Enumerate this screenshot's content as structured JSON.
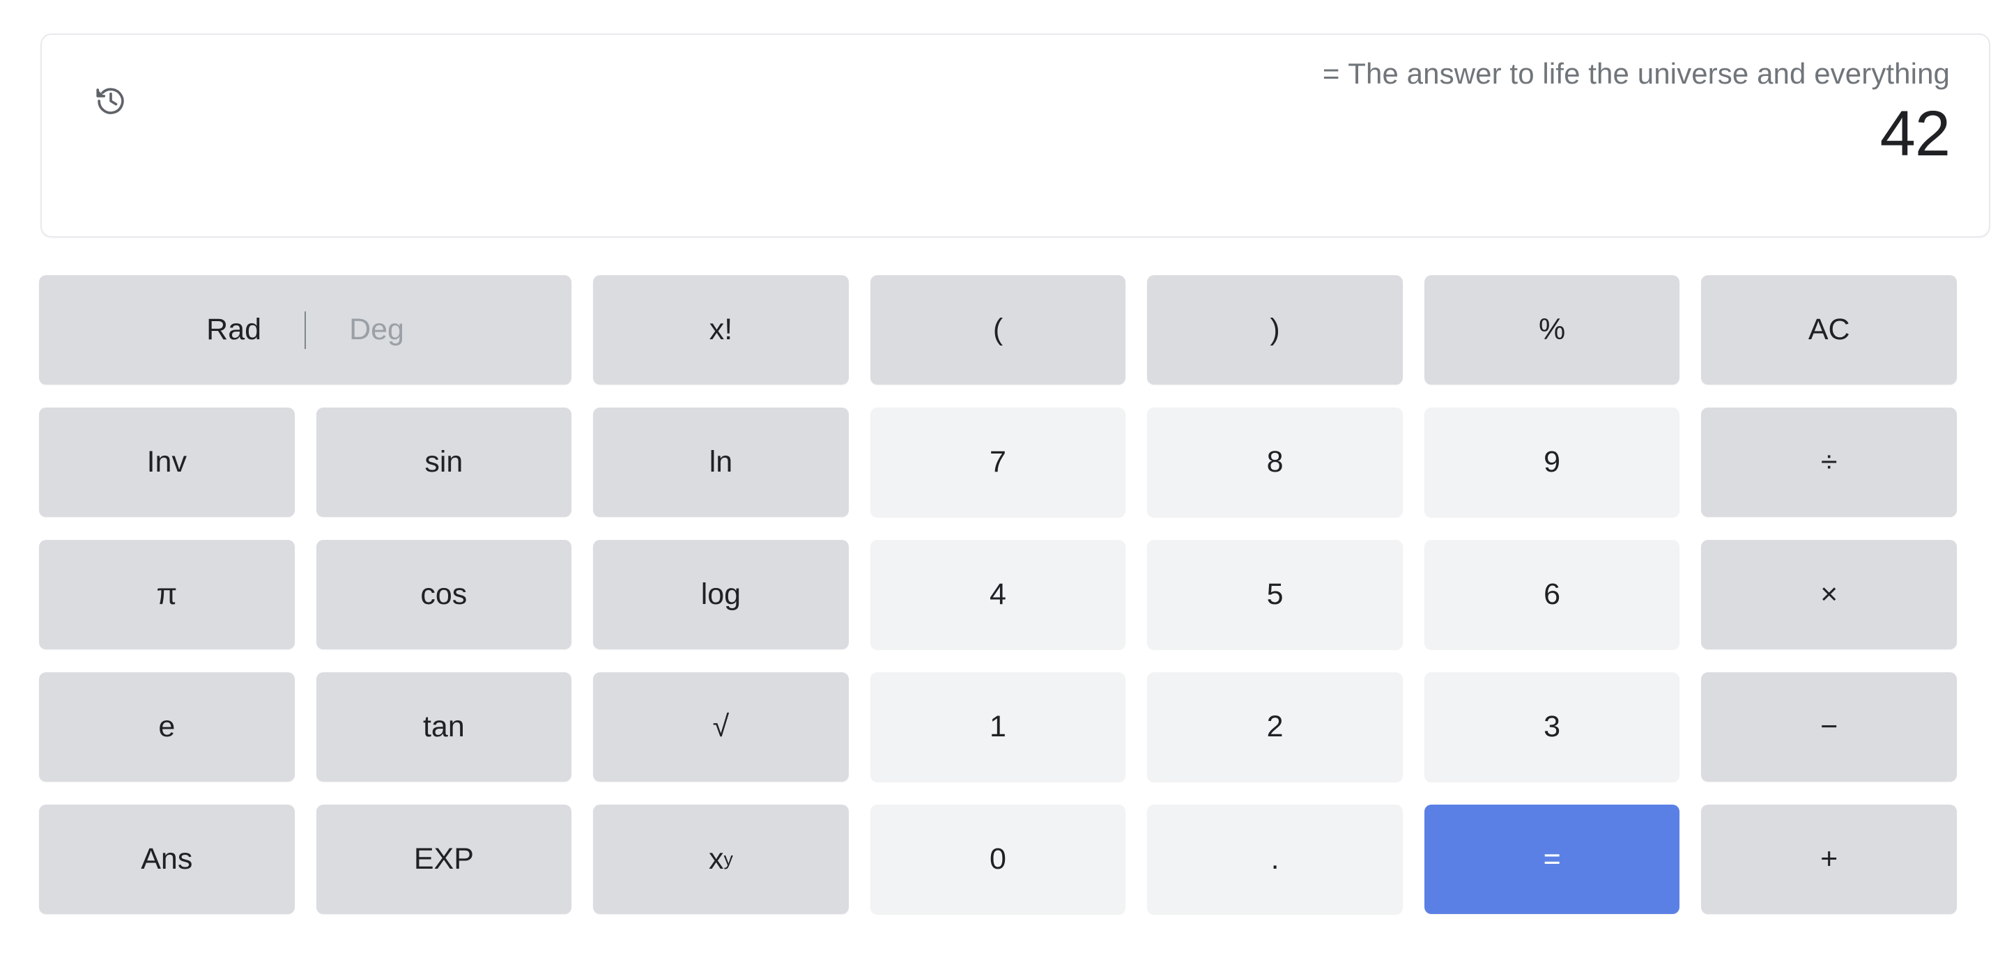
{
  "display": {
    "history_icon": "history-icon",
    "expression": "The answer to life the universe and everything =",
    "result": "42"
  },
  "angle_toggle": {
    "rad_label": "Rad",
    "deg_label": "Deg",
    "selected": "Rad"
  },
  "colors": {
    "function_key": "#dadce0",
    "number_key": "#f1f3f4",
    "equals_key": "#5b80e5",
    "text": "#202124",
    "muted_text": "#70757a",
    "inactive_text": "#9aa0a6"
  },
  "keys": {
    "factorial": "x!",
    "paren_open": "(",
    "paren_close": ")",
    "percent": "%",
    "all_clear": "AC",
    "inverse": "Inv",
    "sin": "sin",
    "ln": "ln",
    "seven": "7",
    "eight": "8",
    "nine": "9",
    "divide": "÷",
    "pi": "π",
    "cos": "cos",
    "log": "log",
    "four": "4",
    "five": "5",
    "six": "6",
    "multiply": "×",
    "euler": "e",
    "tan": "tan",
    "sqrt": "√",
    "one": "1",
    "two": "2",
    "three": "3",
    "minus": "−",
    "answer": "Ans",
    "exponent": "EXP",
    "power_base": "x",
    "power_sup": "y",
    "zero": "0",
    "decimal": ".",
    "equals": "=",
    "plus": "+"
  }
}
